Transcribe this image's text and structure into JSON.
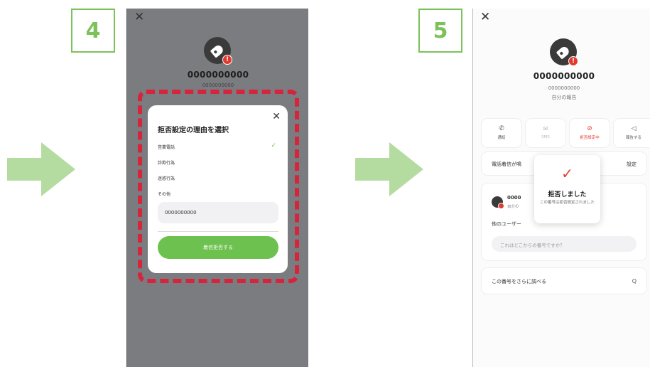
{
  "steps": {
    "left": "4",
    "right": "5"
  },
  "colors": {
    "accent_green": "#7cc15a",
    "dash_red": "#d6243c",
    "button_green": "#6cc14f",
    "block_red": "#e23a2e",
    "overlay_gray": "#7b7c7f"
  },
  "icons": {
    "close": "✕",
    "check": "✓",
    "search": "Q",
    "badge": "!"
  },
  "left_screen": {
    "number": "0000000000",
    "sub_number": "0000000000",
    "modal": {
      "title": "拒否設定の理由を選択",
      "reasons": [
        "営業電話",
        "詐欺行為",
        "迷惑行為",
        "その他"
      ],
      "selected_reason_index": 0,
      "input_value": "0000000000",
      "submit_label": "着信拒否する"
    }
  },
  "right_screen": {
    "number": "0000000000",
    "sub_number": "0000000000",
    "report_label": "自分の報告",
    "actions": [
      {
        "label": "通話",
        "icon": "phone-icon"
      },
      {
        "label": "SMS",
        "icon": "mail-icon"
      },
      {
        "label": "拒否設定中",
        "icon": "block-icon"
      },
      {
        "label": "報告する",
        "icon": "megaphone-icon"
      }
    ],
    "ringtone_row": {
      "label": "電話着信が鳴",
      "action": "設定"
    },
    "report_card": {
      "number": "0000",
      "label": "自分の",
      "other_users": "他のユーザー",
      "placeholder": "これはどこからの番号ですか？"
    },
    "lookup_label": "この番号をさらに調べる",
    "toast": {
      "title": "拒否しました",
      "message": "この番号は拒否設定されました"
    }
  }
}
